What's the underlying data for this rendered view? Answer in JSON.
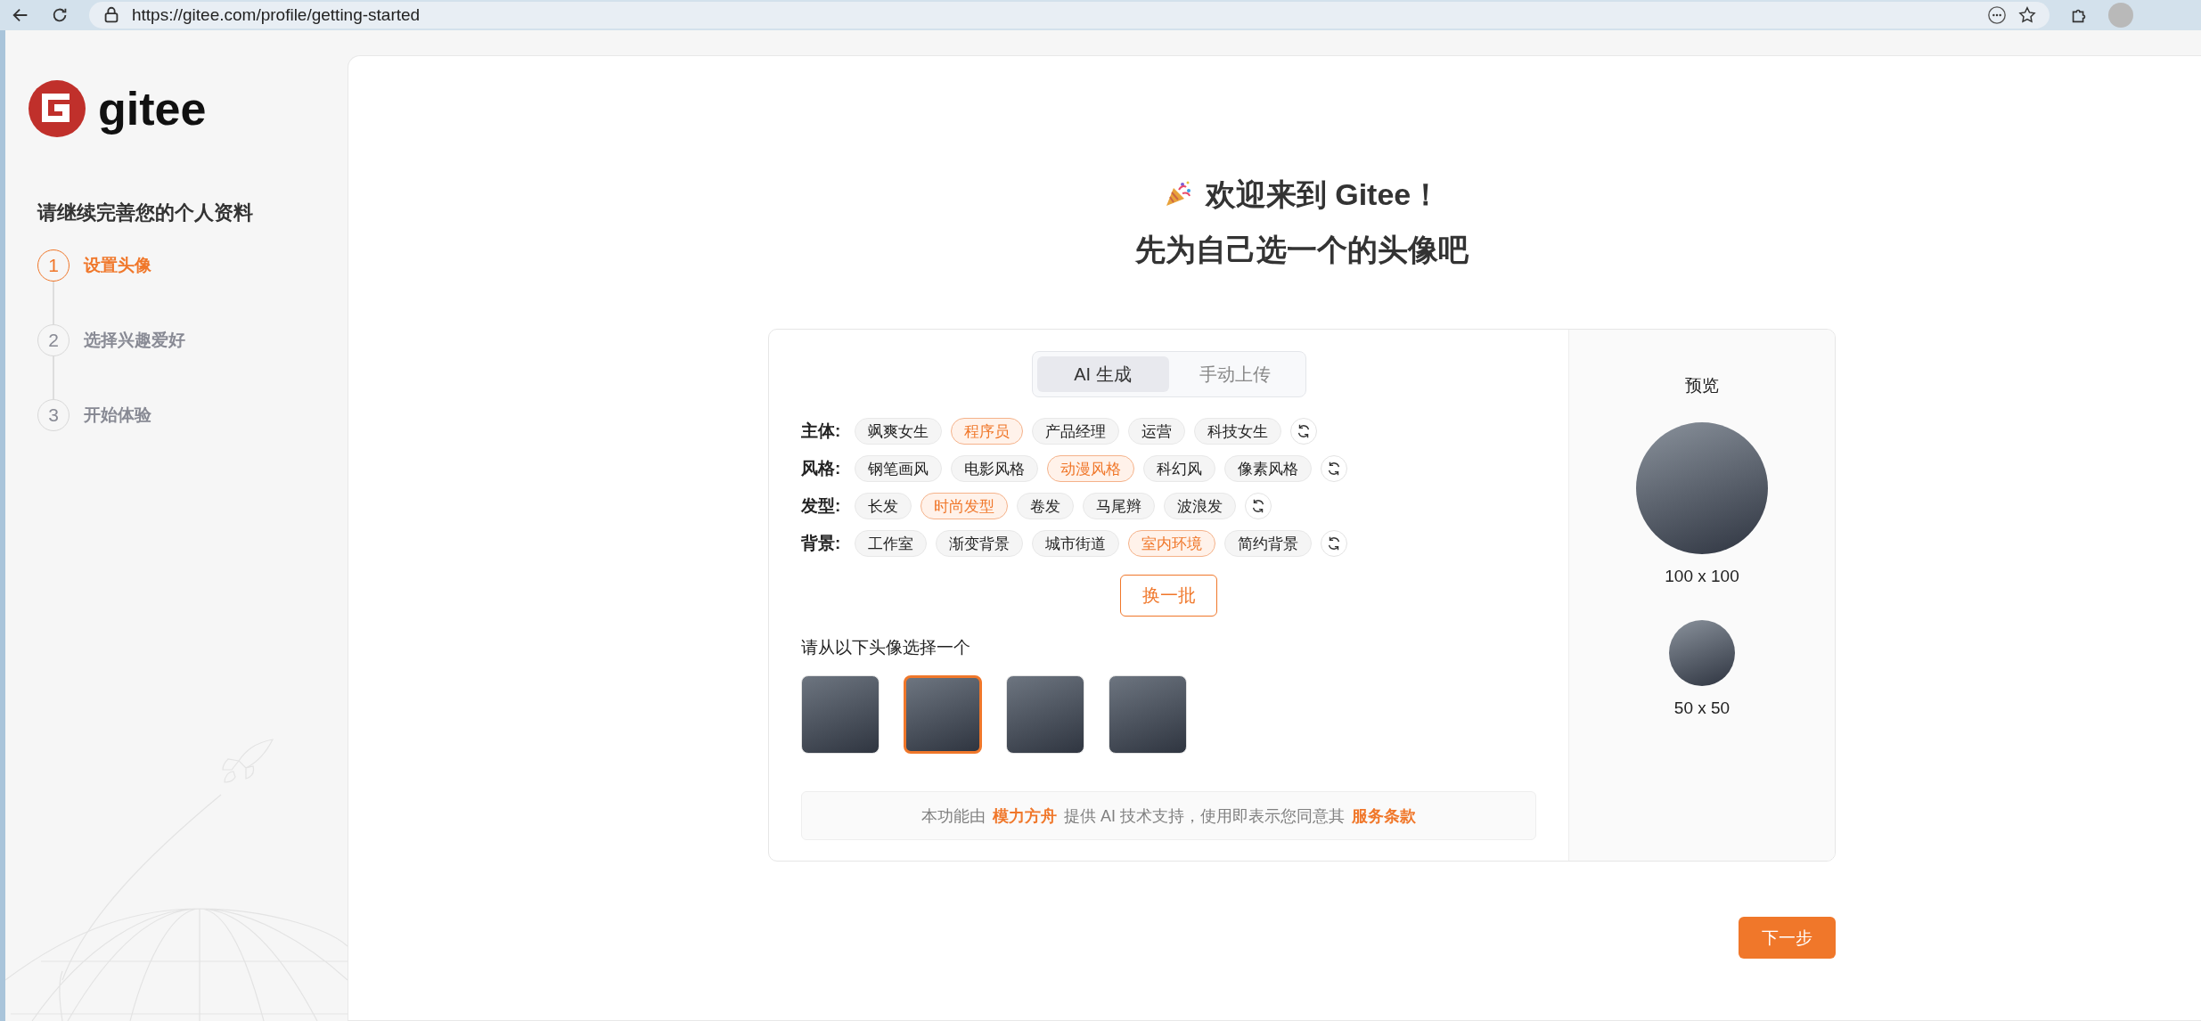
{
  "browser": {
    "url": "https://gitee.com/profile/getting-started"
  },
  "sidebar": {
    "logo_text": "gitee",
    "title": "请继续完善您的个人资料",
    "steps": [
      {
        "number": "1",
        "label": "设置头像",
        "selected": true
      },
      {
        "number": "2",
        "label": "选择兴趣爱好",
        "selected": false
      },
      {
        "number": "3",
        "label": "开始体验",
        "selected": false
      }
    ]
  },
  "main": {
    "heading": "欢迎来到 Gitee！",
    "subheading": "先为自己选一个的头像吧",
    "tabs": [
      {
        "label": "AI 生成",
        "selected": true
      },
      {
        "label": "手动上传",
        "selected": false
      }
    ],
    "tag_rows": [
      {
        "label": "主体:",
        "tags": [
          {
            "label": "飒爽女生",
            "selected": false
          },
          {
            "label": "程序员",
            "selected": true
          },
          {
            "label": "产品经理",
            "selected": false
          },
          {
            "label": "运营",
            "selected": false
          },
          {
            "label": "科技女生",
            "selected": false
          }
        ]
      },
      {
        "label": "风格:",
        "tags": [
          {
            "label": "钢笔画风",
            "selected": false
          },
          {
            "label": "电影风格",
            "selected": false
          },
          {
            "label": "动漫风格",
            "selected": true
          },
          {
            "label": "科幻风",
            "selected": false
          },
          {
            "label": "像素风格",
            "selected": false
          }
        ]
      },
      {
        "label": "发型:",
        "tags": [
          {
            "label": "长发",
            "selected": false
          },
          {
            "label": "时尚发型",
            "selected": true
          },
          {
            "label": "卷发",
            "selected": false
          },
          {
            "label": "马尾辫",
            "selected": false
          },
          {
            "label": "波浪发",
            "selected": false
          }
        ]
      },
      {
        "label": "背景:",
        "tags": [
          {
            "label": "工作室",
            "selected": false
          },
          {
            "label": "渐变背景",
            "selected": false
          },
          {
            "label": "城市街道",
            "selected": false
          },
          {
            "label": "室内环境",
            "selected": true
          },
          {
            "label": "简约背景",
            "selected": false
          }
        ]
      }
    ],
    "shuffle_button": "换一批",
    "avatar_prompt": "请从以下头像选择一个",
    "avatars": [
      {
        "selected": false
      },
      {
        "selected": true
      },
      {
        "selected": false
      },
      {
        "selected": false
      }
    ],
    "notice": [
      {
        "kind": "text",
        "text": "本功能由"
      },
      {
        "kind": "link",
        "text": "模力方舟"
      },
      {
        "kind": "text",
        "text": "提供 AI 技术支持，使用即表示您同意其"
      },
      {
        "kind": "link",
        "text": "服务条款"
      }
    ],
    "preview": {
      "title": "预览",
      "sizes": [
        {
          "kind": "large",
          "label": "100 x 100"
        },
        {
          "kind": "small",
          "label": "50 x 50"
        }
      ]
    },
    "next_button": "下一步"
  }
}
